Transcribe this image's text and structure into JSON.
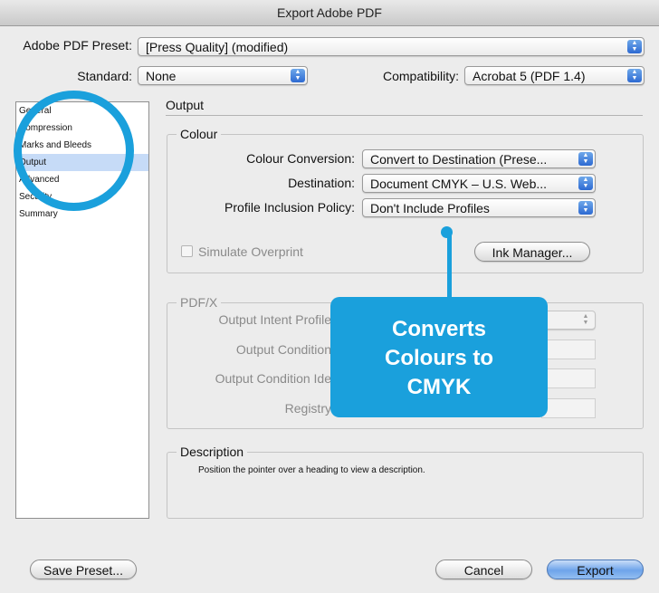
{
  "window": {
    "title": "Export Adobe PDF"
  },
  "preset": {
    "label": "Adobe PDF Preset:",
    "value": "[Press Quality] (modified)"
  },
  "standard": {
    "label": "Standard:",
    "value": "None"
  },
  "compatibility": {
    "label": "Compatibility:",
    "value": "Acrobat 5 (PDF 1.4)"
  },
  "sidebar": {
    "items": [
      {
        "label": "General"
      },
      {
        "label": "Compression"
      },
      {
        "label": "Marks and Bleeds"
      },
      {
        "label": "Output"
      },
      {
        "label": "Advanced"
      },
      {
        "label": "Security"
      },
      {
        "label": "Summary"
      }
    ],
    "selected": "Output"
  },
  "section": {
    "title": "Output"
  },
  "colour": {
    "title": "Colour",
    "conversion_label": "Colour Conversion:",
    "conversion_value": "Convert to Destination (Prese...",
    "destination_label": "Destination:",
    "destination_value": "Document CMYK – U.S. Web...",
    "profile_label": "Profile Inclusion Policy:",
    "profile_value": "Don't Include Profiles",
    "simulate_label": "Simulate Overprint",
    "ink_manager_label": "Ink Manager..."
  },
  "pdfx": {
    "title": "PDF/X",
    "output_intent_label": "Output Intent Profile",
    "output_condition_label": "Output Condition",
    "output_condition_id_label": "Output Condition Ide",
    "registry_label": "Registry"
  },
  "description": {
    "title": "Description",
    "text": "Position the pointer over a heading to view a description."
  },
  "callout": {
    "line1": "Converts",
    "line2": "Colours to",
    "line3": "CMYK"
  },
  "footer": {
    "save_preset": "Save Preset...",
    "cancel": "Cancel",
    "export": "Export"
  },
  "colors": {
    "callout": "#1aa0dc",
    "accent": "#2d6ad2"
  }
}
